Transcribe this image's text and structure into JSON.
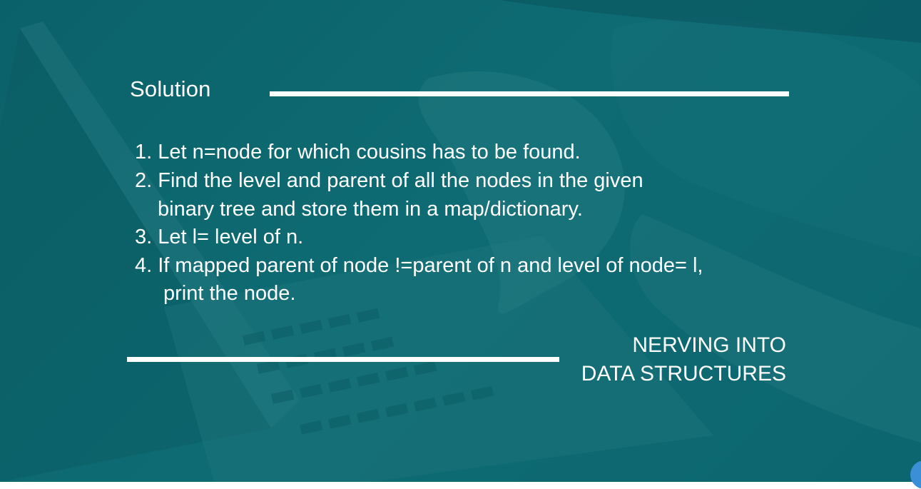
{
  "slide": {
    "title": "Solution",
    "steps": [
      "1. Let n=node for which cousins has to be found.",
      "2. Find the level and parent of all the nodes in the given",
      "binary tree and store them in a map/dictionary.",
      "3. Let l= level of n.",
      "4. If mapped parent of node !=parent of n and level of node= l,",
      "print the node."
    ],
    "brand": {
      "line1": "NERVING INTO",
      "line2": "DATA STRUCTURES"
    }
  },
  "colors": {
    "background": "#0d6870",
    "text": "#ffffff",
    "accent_dot": "#3a8fd6"
  },
  "background_image": {
    "subject": "laptop-and-hands-photo",
    "overlay": "teal tint"
  }
}
